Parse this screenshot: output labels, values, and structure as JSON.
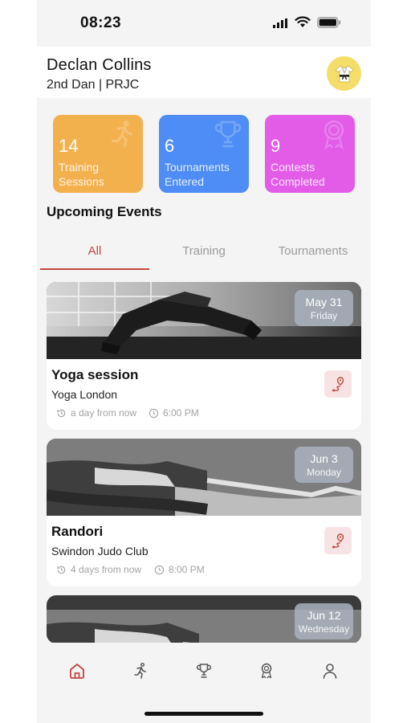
{
  "status": {
    "time": "08:23"
  },
  "user": {
    "name": "Declan Collins",
    "rank": "2nd Dan | PRJC"
  },
  "stats": [
    {
      "value": "14",
      "label_line1": "Training",
      "label_line2": "Sessions",
      "color": "#f3b14e"
    },
    {
      "value": "6",
      "label_line1": "Tournaments",
      "label_line2": "Entered",
      "color": "#4e8cf6"
    },
    {
      "value": "9",
      "label_line1": "Contests",
      "label_line2": "Completed",
      "color": "#e25ce8"
    }
  ],
  "section_title": "Upcoming Events",
  "tabs": [
    {
      "label": "All",
      "active": true
    },
    {
      "label": "Training",
      "active": false
    },
    {
      "label": "Tournaments",
      "active": false
    }
  ],
  "events": [
    {
      "title": "Yoga session",
      "venue": "Yoga London",
      "relative": "a day from now",
      "time": "6:00 PM",
      "date": "May 31",
      "weekday": "Friday"
    },
    {
      "title": "Randori",
      "venue": "Swindon Judo Club",
      "relative": "4 days from now",
      "time": "8:00 PM",
      "date": "Jun 3",
      "weekday": "Monday"
    },
    {
      "title": "",
      "venue": "",
      "relative": "",
      "time": "",
      "date": "Jun 12",
      "weekday": "Wednesday"
    }
  ],
  "nav": {
    "items": [
      "home-icon",
      "running-icon",
      "trophy-icon",
      "medal-icon",
      "profile-icon"
    ],
    "active": "home-icon"
  },
  "colors": {
    "accent": "#c0483f",
    "inactive": "#9b9b9b",
    "background": "#f4f4f5"
  }
}
